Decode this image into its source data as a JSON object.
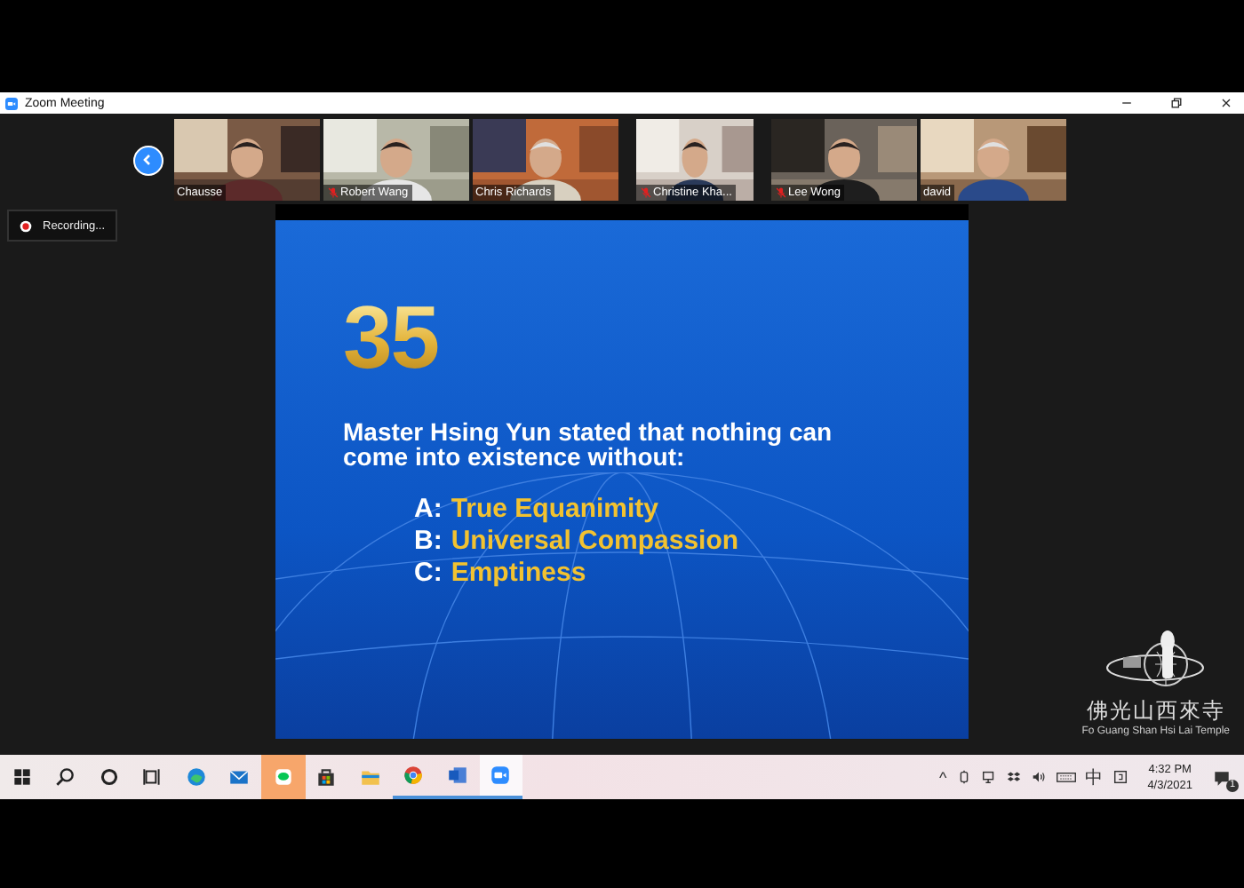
{
  "window": {
    "title": "Zoom Meeting"
  },
  "recording": {
    "label": "Recording..."
  },
  "participants": [
    {
      "name": "Chausse",
      "muted": false
    },
    {
      "name": "Robert Wang",
      "muted": true
    },
    {
      "name": "Chris Richards",
      "muted": false
    },
    {
      "name": "Christine Kha...",
      "muted": true
    },
    {
      "name": "Lee Wong",
      "muted": true
    },
    {
      "name": "david",
      "muted": false
    }
  ],
  "slide": {
    "number": "35",
    "question": "Master Hsing Yun stated that nothing can come into existence without:",
    "options": [
      {
        "letter": "A:",
        "text": "True Equanimity"
      },
      {
        "letter": "B:",
        "text": "Universal Compassion"
      },
      {
        "letter": "C:",
        "text": "Emptiness"
      }
    ]
  },
  "logo": {
    "name": "佛光山西來寺",
    "subtitle": "Fo Guang Shan Hsi Lai Temple"
  },
  "taskbar": {
    "apps": [
      {
        "kind": "start",
        "running": false,
        "focused": false,
        "flashing": false
      },
      {
        "kind": "search",
        "running": false,
        "focused": false,
        "flashing": false
      },
      {
        "kind": "cortana",
        "running": false,
        "focused": false,
        "flashing": false
      },
      {
        "kind": "taskview",
        "running": false,
        "focused": false,
        "flashing": false
      },
      {
        "kind": "edge",
        "running": false,
        "focused": false,
        "flashing": false
      },
      {
        "kind": "mail",
        "running": false,
        "focused": false,
        "flashing": false
      },
      {
        "kind": "chat",
        "running": false,
        "focused": false,
        "flashing": true
      },
      {
        "kind": "store",
        "running": false,
        "focused": false,
        "flashing": false
      },
      {
        "kind": "folder",
        "running": false,
        "focused": false,
        "flashing": false
      },
      {
        "kind": "chrome",
        "running": true,
        "focused": false,
        "flashing": false
      },
      {
        "kind": "word",
        "running": true,
        "focused": false,
        "flashing": false
      },
      {
        "kind": "zoom",
        "running": true,
        "focused": true,
        "flashing": false
      }
    ],
    "chevron": "^",
    "ime": "中",
    "time": "4:32 PM",
    "date": "4/3/2021",
    "notifications": "1"
  }
}
